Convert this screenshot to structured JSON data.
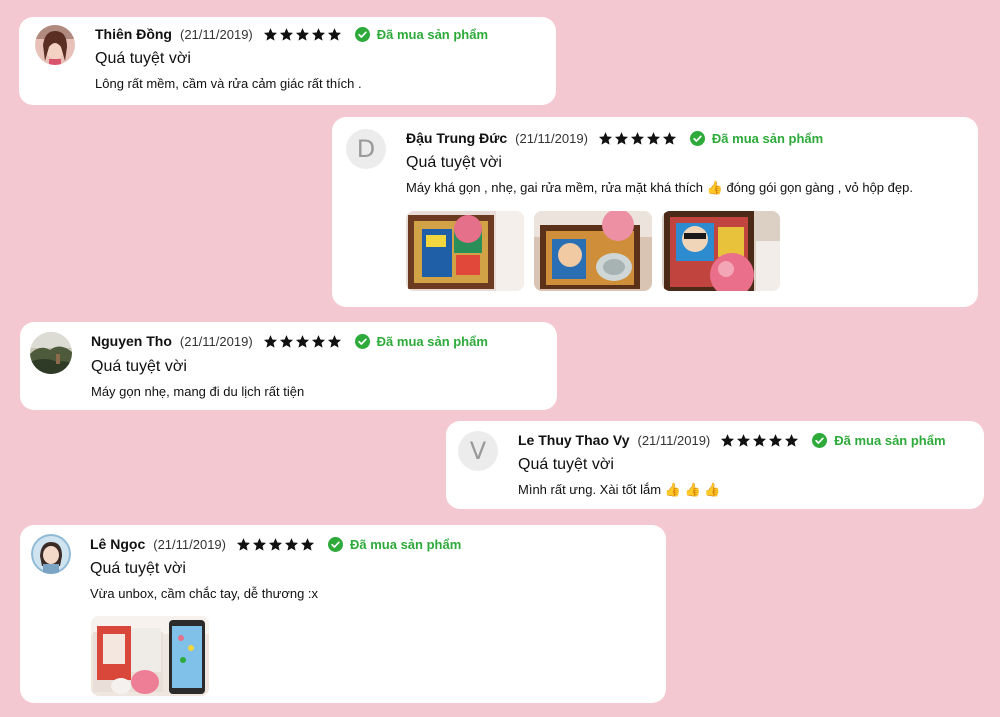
{
  "reviews": [
    {
      "reviewer": "Thiên Đồng",
      "date": "(21/11/2019)",
      "rating": 5,
      "verified_label": "Đã mua sản phẩm",
      "title": "Quá tuyệt vời",
      "body": "Lông rất mềm, cầm và rửa cảm giác rất thích .",
      "avatar": "photo-avatar-woman"
    },
    {
      "reviewer": "Đậu Trung Đức",
      "date": "(21/11/2019)",
      "rating": 5,
      "verified_label": "Đã mua sản phẩm",
      "title": "Quá tuyệt vời",
      "body": "Máy khá gọn , nhẹ, gai rửa mềm, rửa mặt khá thích 👍  đóng gói gọn gàng , vỏ hộp đẹp.",
      "avatar_letter": "D",
      "photos": [
        "product-box-photo",
        "product-box-photo",
        "product-box-photo"
      ]
    },
    {
      "reviewer": "Nguyen Tho",
      "date": "(21/11/2019)",
      "rating": 5,
      "verified_label": "Đã mua sản phẩm",
      "title": "Quá tuyệt vời",
      "body": "Máy gọn nhẹ, mang đi du lịch rất tiện",
      "avatar": "photo-avatar-landscape"
    },
    {
      "reviewer": "Le Thuy Thao Vy",
      "date": "(21/11/2019)",
      "rating": 5,
      "verified_label": "Đã mua sản phẩm",
      "title": "Quá tuyệt vời",
      "body": "Mình rất ưng. Xài tốt lắm 👍  👍  👍",
      "avatar_letter": "V"
    },
    {
      "reviewer": "Lê Ngọc",
      "date": "(21/11/2019)",
      "rating": 5,
      "verified_label": "Đã mua sản phẩm",
      "title": "Quá tuyệt vời",
      "body": "Vừa unbox, cầm chắc tay, dễ thương :x",
      "avatar": "photo-avatar-girl",
      "photos": [
        "product-unbox-photo"
      ]
    }
  ],
  "colors": {
    "background": "#f4c8d1",
    "card": "#ffffff",
    "verified_green": "#2daa3a",
    "star": "#111111"
  }
}
